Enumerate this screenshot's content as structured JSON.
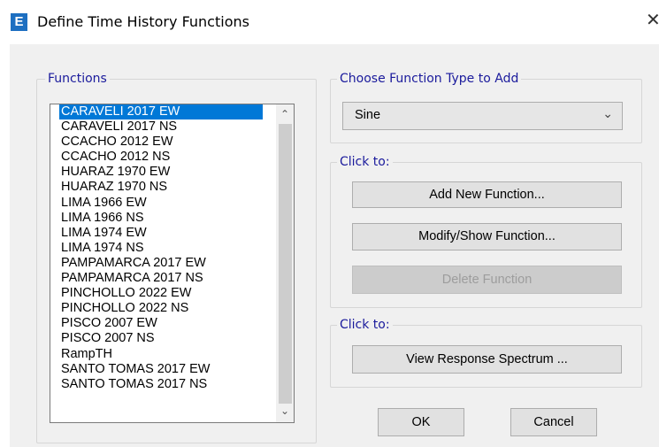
{
  "window": {
    "title": "Define Time History Functions",
    "app_icon": "E",
    "close": "✕"
  },
  "functions": {
    "legend": "Functions",
    "selected_index": 0,
    "items": [
      "CARAVELI 2017 EW",
      "CARAVELI 2017 NS",
      "CCACHO 2012 EW",
      "CCACHO 2012 NS",
      "HUARAZ 1970 EW",
      "HUARAZ 1970 NS",
      "LIMA 1966 EW",
      "LIMA 1966 NS",
      "LIMA 1974 EW",
      "LIMA 1974 NS",
      "PAMPAMARCA 2017 EW",
      "PAMPAMARCA 2017 NS",
      "PINCHOLLO 2022 EW",
      "PINCHOLLO 2022 NS",
      "PISCO 2007 EW",
      "PISCO 2007 NS",
      "RampTH",
      "SANTO TOMAS 2017 EW",
      "SANTO TOMAS 2017 NS"
    ]
  },
  "function_type": {
    "legend": "Choose  Function Type to Add",
    "selected": "Sine"
  },
  "click_to_1": {
    "legend": "Click to:",
    "add_label": "Add New Function...",
    "modify_label": "Modify/Show Function...",
    "delete_label": "Delete Function"
  },
  "click_to_2": {
    "legend": "Click to:",
    "view_label": "View Response Spectrum ..."
  },
  "buttons": {
    "ok": "OK",
    "cancel": "Cancel"
  }
}
